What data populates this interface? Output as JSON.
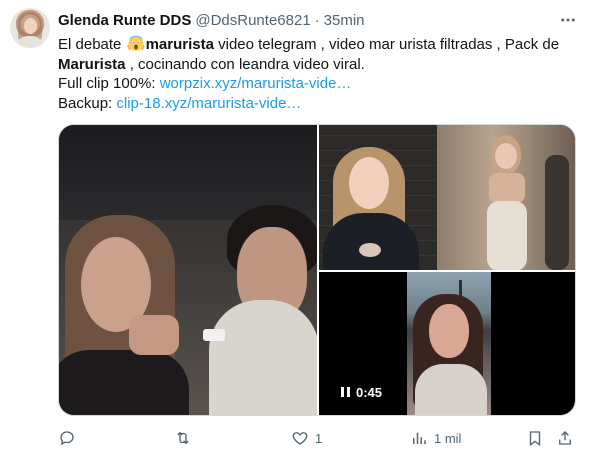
{
  "author": {
    "name": "Glenda Runte DDS",
    "handle": "@DdsRunte6821",
    "separator": "·",
    "time": "35min"
  },
  "tweet": {
    "line1_pre": "El debate ",
    "line1_bold": "marurista",
    "line1_post": " video telegram , video mar urista filtradas , Pack de",
    "line2_bold": "Marurista",
    "line2_post": "  , cocinando con leandra video viral.",
    "line3_label": "Full clip 100%: ",
    "line3_link": "worpzix.xyz/marurista-vide…",
    "line4_label": "Backup: ",
    "line4_link": "clip-18.xyz/marurista-vide…"
  },
  "media": {
    "video_duration": "0:45"
  },
  "actions": {
    "reply_count": "",
    "retweet_count": "",
    "like_count": "1",
    "views_count": "1 mil"
  },
  "icons": {
    "more": "more-icon",
    "reply": "reply-icon",
    "retweet": "retweet-icon",
    "like": "like-icon",
    "views": "views-icon",
    "bookmark": "bookmark-icon",
    "share": "share-icon",
    "emoji": "scream-emoji-icon"
  },
  "colors": {
    "link": "#1d9bf0",
    "secondary": "#536471",
    "text": "#0f1419"
  }
}
